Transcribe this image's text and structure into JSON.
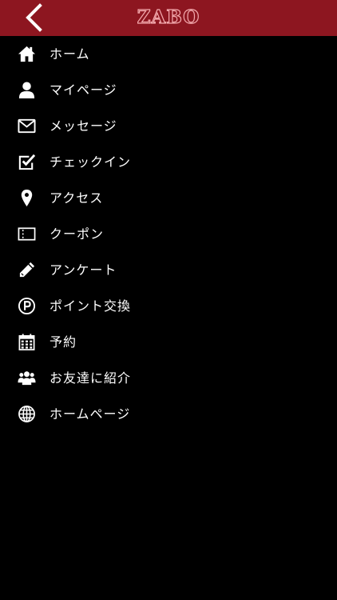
{
  "header": {
    "logo_text": "ZABO",
    "back_icon": "chevron-left-icon",
    "background_color": "#8d1620"
  },
  "menu": {
    "items": [
      {
        "label": "ホーム",
        "icon": "home-icon"
      },
      {
        "label": "マイページ",
        "icon": "user-icon"
      },
      {
        "label": "メッセージ",
        "icon": "envelope-icon"
      },
      {
        "label": "チェックイン",
        "icon": "checkbox-icon"
      },
      {
        "label": "アクセス",
        "icon": "map-pin-icon"
      },
      {
        "label": "クーポン",
        "icon": "ticket-icon"
      },
      {
        "label": "アンケート",
        "icon": "pencil-icon"
      },
      {
        "label": "ポイント交換",
        "icon": "point-icon"
      },
      {
        "label": "予約",
        "icon": "calendar-icon"
      },
      {
        "label": "お友達に紹介",
        "icon": "users-icon"
      },
      {
        "label": "ホームページ",
        "icon": "globe-icon"
      }
    ]
  }
}
